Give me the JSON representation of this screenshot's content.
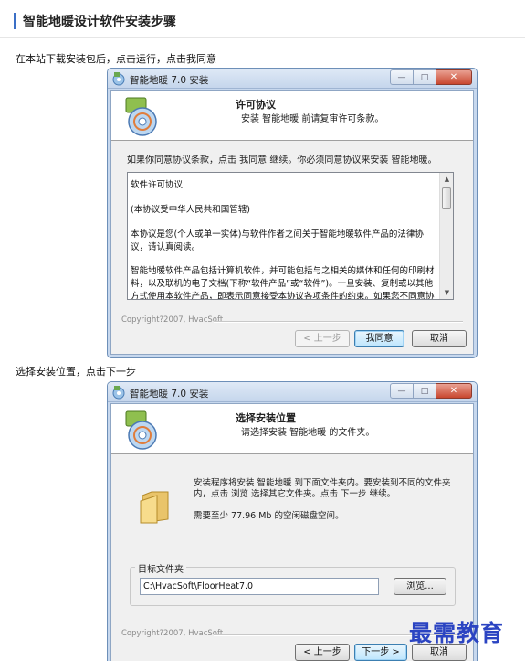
{
  "page": {
    "title": "智能地暖设计软件安装步骤",
    "step1": "在本站下载安装包后，点击运行，点击我同意",
    "step2": "选择安装位置，点击下一步"
  },
  "window_title": "智能地暖 7.0 安装",
  "window_controls": {
    "minimize": "—",
    "maximize": "□",
    "close": "✕"
  },
  "dialog_license": {
    "heading": "许可协议",
    "subheading": "安装 智能地暖 前请复审许可条款。",
    "intro": "如果你同意协议条款，点击 我同意 继续。你必须同意协议来安装 智能地暖。",
    "license_paragraphs": [
      "软件许可协议",
      "(本协议受中华人民共和国管辖)",
      "本协议是您(个人或单一实体)与软件作者之间关于智能地暖软件产品的法律协议，请认真阅读。",
      "智能地暖软件产品包括计算机软件，并可能包括与之相关的媒体和任何的印刷材料，以及联机的电子文档(下称“软件产品”或“软件”)。一旦安装、复制或以其他方式使用本软件产品，即表示同意接受本协议各项条件的约束。如果您不同意协"
    ],
    "brand": "Copyright?2007, HvacSoft",
    "back_label": "< 上一步",
    "agree_label": "我同意",
    "cancel_label": "取消"
  },
  "dialog_location": {
    "heading": "选择安装位置",
    "subheading": "请选择安装 智能地暖 的文件夹。",
    "description": "安装程序将安装 智能地暖 到下面文件夹内。要安装到不同的文件夹内，点击 浏览 选择其它文件夹。点击 下一步 继续。",
    "space_required": "需要至少 77.96 Mb 的空闲磁盘空间。",
    "folder_label": "目标文件夹",
    "folder_path": "C:\\HvacSoft\\FloorHeat7.0",
    "browse_label": "浏览...",
    "brand": "Copyright?2007, HvacSoft",
    "back_label": "< 上一步",
    "next_label": "下一步 >",
    "cancel_label": "取消"
  },
  "watermark": "最需教育"
}
